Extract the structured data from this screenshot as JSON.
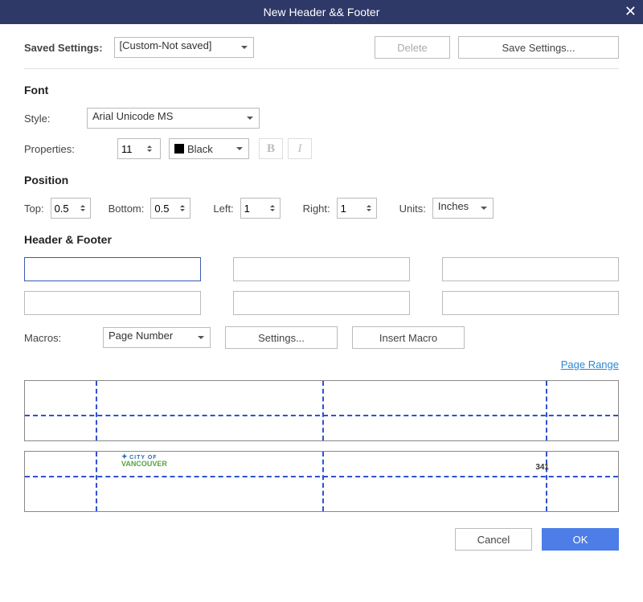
{
  "title": "New Header && Footer",
  "savedSettings": {
    "label": "Saved Settings:",
    "value": "[Custom-Not saved]"
  },
  "buttons": {
    "delete": "Delete",
    "saveSettings": "Save Settings...",
    "settings": "Settings...",
    "insertMacro": "Insert Macro",
    "cancel": "Cancel",
    "ok": "OK"
  },
  "sections": {
    "font": "Font",
    "position": "Position",
    "hf": "Header & Footer"
  },
  "font": {
    "styleLabel": "Style:",
    "styleValue": "Arial Unicode MS",
    "propsLabel": "Properties:",
    "size": "11",
    "color": "Black",
    "bold": "B",
    "italic": "I"
  },
  "position": {
    "topLabel": "Top:",
    "top": "0.5",
    "bottomLabel": "Bottom:",
    "bottom": "0.5",
    "leftLabel": "Left:",
    "left": "1",
    "rightLabel": "Right:",
    "right": "1",
    "unitsLabel": "Units:",
    "units": "Inches"
  },
  "macros": {
    "label": "Macros:",
    "value": "Page Number"
  },
  "pageRange": "Page Range",
  "preview": {
    "brandTag": "CITY OF",
    "brandName": "VANCOUVER",
    "pageNum": "341"
  }
}
